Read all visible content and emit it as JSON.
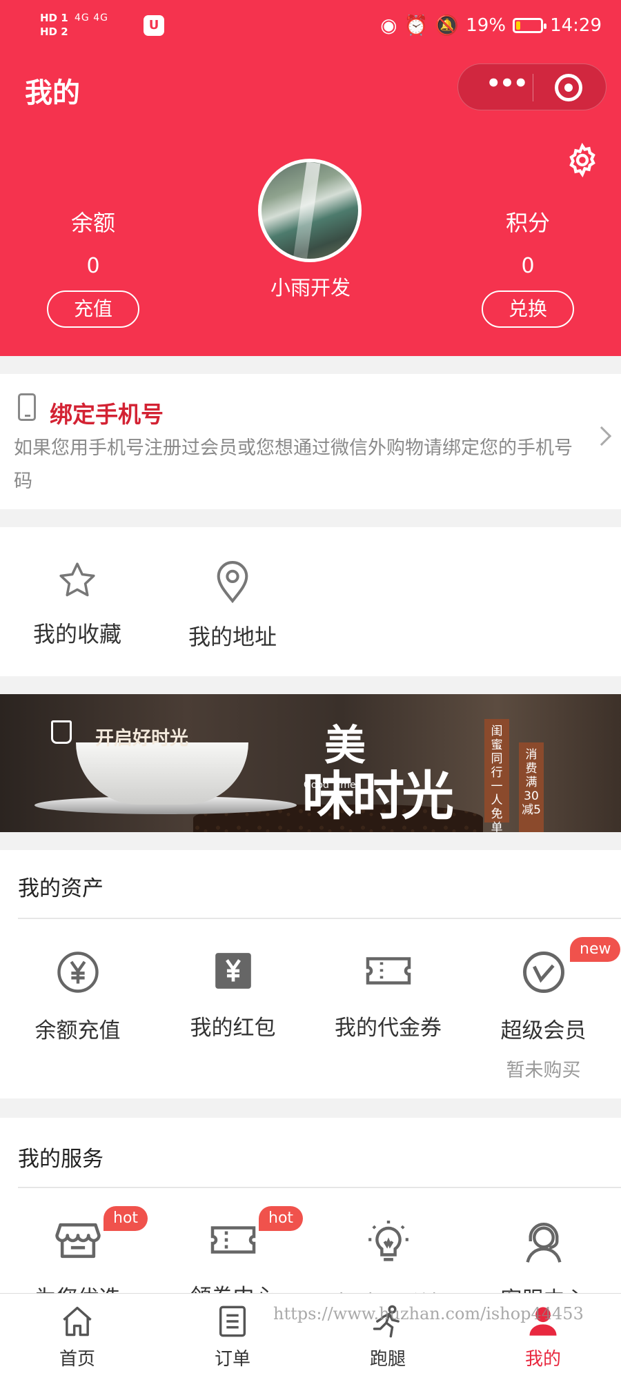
{
  "status_bar": {
    "sim": "HD 1\nHD 2",
    "network": "4G 4G",
    "battery": "19%",
    "battery_level": 0.19,
    "time": "14:29"
  },
  "header": {
    "title": "我的",
    "capsule_more": "•••"
  },
  "profile": {
    "nickname": "小雨开发",
    "balance": {
      "label": "余额",
      "value": "0",
      "button": "充值"
    },
    "points": {
      "label": "积分",
      "value": "0",
      "button": "兑换"
    }
  },
  "bind_phone": {
    "title": "绑定手机号",
    "description": "如果您用手机号注册过会员或您想通过微信外购物请绑定您的手机号码"
  },
  "quick_links": [
    {
      "label": "我的收藏",
      "icon": "star-icon"
    },
    {
      "label": "我的地址",
      "icon": "location-pin-icon"
    }
  ],
  "banner": {
    "slogan": "开启好时光",
    "title_line1": "美",
    "title_line2": "味时光",
    "english": "Good Time",
    "tag1": "闺蜜同行 一人免单",
    "tag2": "消费满30减5"
  },
  "assets": {
    "title": "我的资产",
    "items": [
      {
        "label": "余额充值",
        "icon": "yuan-circle-icon"
      },
      {
        "label": "我的红包",
        "icon": "red-packet-icon"
      },
      {
        "label": "我的代金券",
        "icon": "coupon-icon"
      },
      {
        "label": "超级会员",
        "icon": "vip-icon",
        "badge": "new",
        "sub": "暂未购买"
      }
    ]
  },
  "services": {
    "title": "我的服务",
    "items": [
      {
        "label": "为您优选",
        "icon": "store-icon",
        "badge": "hot"
      },
      {
        "label": "领券中心",
        "icon": "ticket-icon",
        "badge": "hot"
      },
      {
        "label": "帮助与反馈",
        "icon": "lightbulb-icon"
      },
      {
        "label": "客服中心",
        "icon": "customer-service-icon"
      }
    ]
  },
  "tabbar": {
    "items": [
      {
        "label": "首页",
        "icon": "home-icon"
      },
      {
        "label": "订单",
        "icon": "order-list-icon"
      },
      {
        "label": "跑腿",
        "icon": "runner-icon"
      },
      {
        "label": "我的",
        "icon": "user-icon",
        "active": true
      }
    ]
  },
  "watermark": "https://www.huzhan.com/ishop44453",
  "colors": {
    "brand": "#f5334e",
    "accent_text": "#d32233",
    "badge": "#f0524c",
    "tab_active": "#e8283f"
  }
}
